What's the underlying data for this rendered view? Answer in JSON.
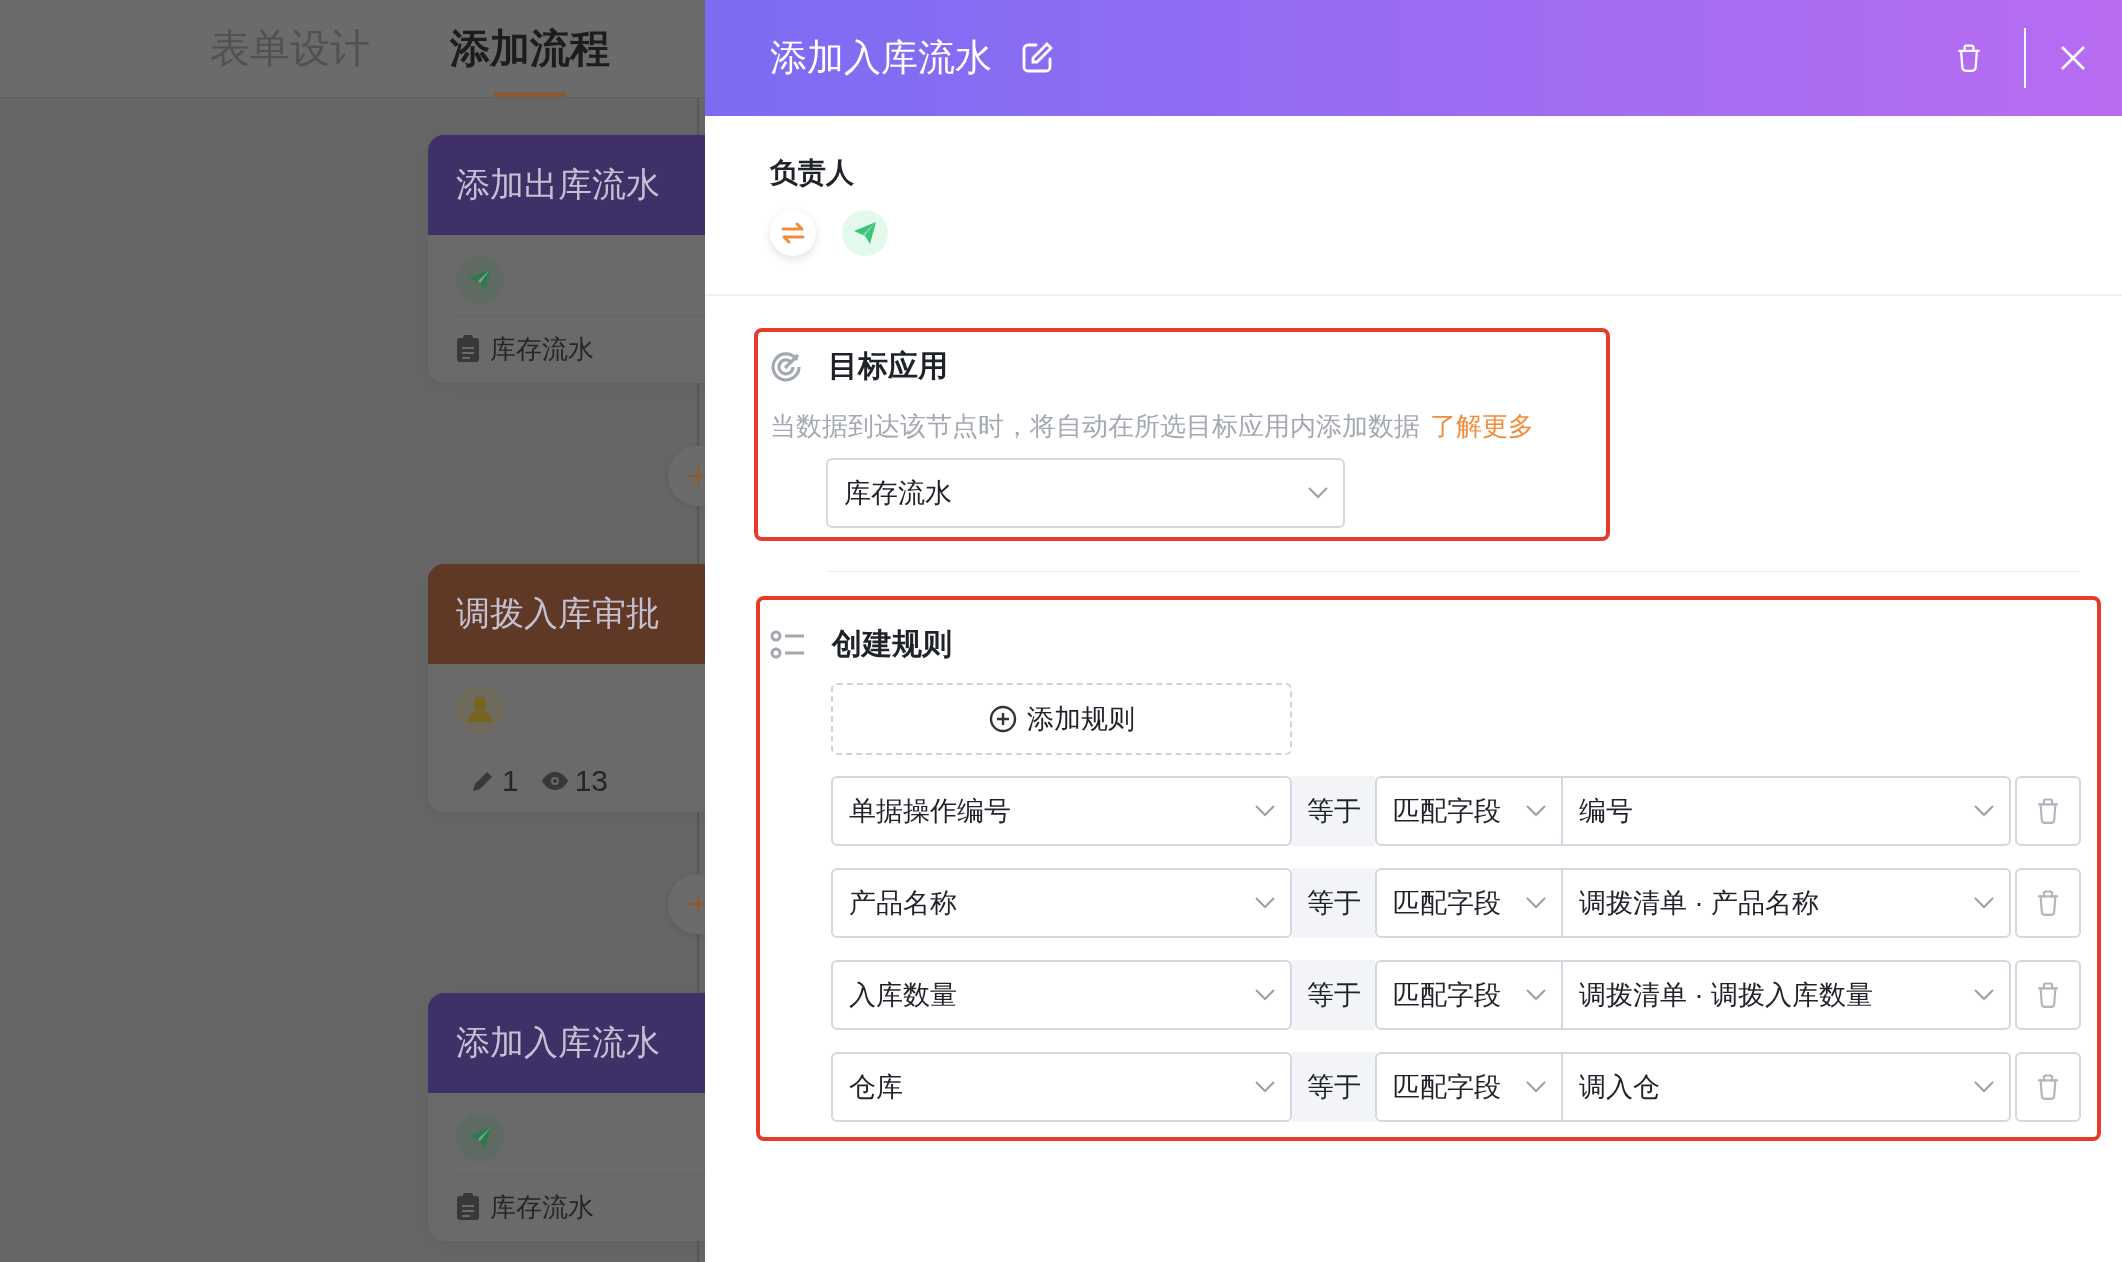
{
  "tabs": [
    {
      "label": "表单设计",
      "selected": false
    },
    {
      "label": "添加流程",
      "selected": true
    }
  ],
  "flow_nodes": [
    {
      "kind": "action",
      "title": "添加出库流水",
      "color": "#3f3068",
      "app": "库存流水"
    },
    {
      "kind": "approval",
      "title": "调拨入库审批",
      "color": "#5f3826",
      "edit_count": "1",
      "view_count": "13"
    },
    {
      "kind": "action",
      "title": "添加入库流水",
      "color": "#3f3068",
      "app": "库存流水"
    }
  ],
  "drawer": {
    "title": "添加入库流水",
    "assignee_label": "负责人",
    "target": {
      "title": "目标应用",
      "description": "当数据到达该节点时，将自动在所选目标应用内添加数据",
      "link": "了解更多",
      "app": "库存流水"
    },
    "rules": {
      "title": "创建规则",
      "add_button": "添加规则",
      "rows": [
        {
          "field": "单据操作编号",
          "operator": "等于",
          "mode": "匹配字段",
          "value": "编号"
        },
        {
          "field": "产品名称",
          "operator": "等于",
          "mode": "匹配字段",
          "value": "调拨清单 · 产品名称"
        },
        {
          "field": "入库数量",
          "operator": "等于",
          "mode": "匹配字段",
          "value": "调拨清单 · 调拨入库数量"
        },
        {
          "field": "仓库",
          "operator": "等于",
          "mode": "匹配字段",
          "value": "调入仓"
        }
      ]
    }
  }
}
